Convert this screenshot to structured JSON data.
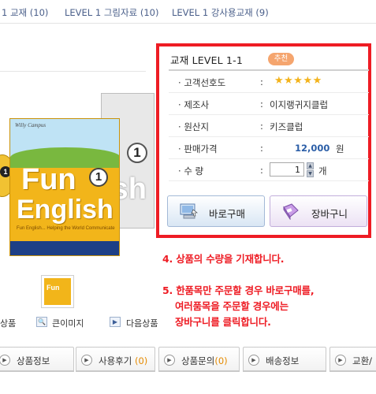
{
  "top_tabs": [
    {
      "label": "1 교재",
      "count": "(10)"
    },
    {
      "label": "LEVEL 1 그림자료",
      "count": "(10)"
    },
    {
      "label": "LEVEL 1 강사용교재",
      "count": "(9)"
    }
  ],
  "product_image": {
    "brand": "Willy Campus",
    "title_line1": "Fun",
    "title_line2": "English",
    "level_number": "1",
    "back_cover_text": "ish",
    "tagline": "Fun English... Helping the World Communicate",
    "cd_label": "1"
  },
  "product": {
    "title": "교재 LEVEL 1-1",
    "badge": "추천",
    "rows": {
      "rating": {
        "label": "고객선호도",
        "colon": ":",
        "stars": "★★★★★",
        "star_color": "#f3b31b"
      },
      "maker": {
        "label": "제조사",
        "colon": ":",
        "value": "이지랭귀지클럽"
      },
      "origin": {
        "label": "원산지",
        "colon": ":",
        "value": "키즈클럽"
      },
      "price": {
        "label": "판매가격",
        "colon": ":",
        "value": "12,000",
        "unit": "원"
      },
      "quantity": {
        "label": "수 량",
        "colon": ":",
        "value": "1",
        "unit": "개"
      }
    }
  },
  "buttons": {
    "buy": "바로구매",
    "cart": "장바구니"
  },
  "notes": {
    "note4": "4. 상품의 수량을 기재합니다.",
    "note5_line1": "5. 한품목만 주문할 경우 바로구매를,",
    "note5_line2": "여러품목을 주문할 경우에는",
    "note5_line3": "장바구니를 클릭합니다."
  },
  "image_links": {
    "prev": "상품",
    "zoom": "큰이미지",
    "next": "다음상품"
  },
  "bottom_tabs": [
    {
      "label": "상품정보",
      "count": ""
    },
    {
      "label": "사용후기",
      "count": "(0)"
    },
    {
      "label": "상품문의",
      "count": "(0)"
    },
    {
      "label": "배송정보",
      "count": ""
    },
    {
      "label": "교환/",
      "count": ""
    }
  ],
  "colors": {
    "highlight_frame": "#ee1c24",
    "note_text": "#ee1c24",
    "price_text": "#2b5ea7",
    "badge": "#f5a56e",
    "count_text": "#e58a00"
  }
}
